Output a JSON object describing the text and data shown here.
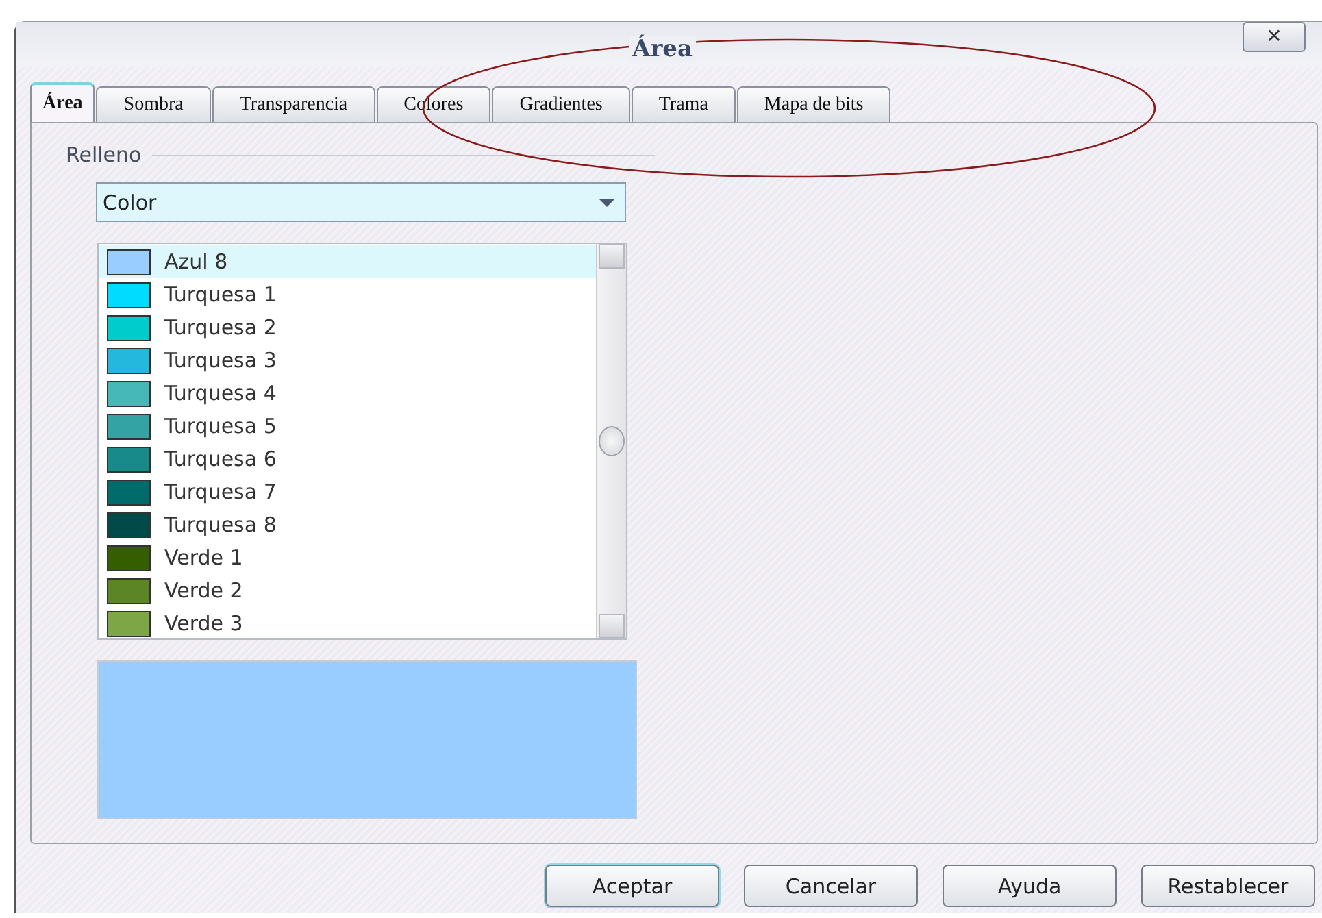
{
  "window": {
    "title": "Área",
    "close": "✕"
  },
  "tabs": [
    {
      "label": "Área",
      "selected": true
    },
    {
      "label": "Sombra",
      "selected": false
    },
    {
      "label": "Transparencia",
      "selected": false
    },
    {
      "label": "Colores",
      "selected": false
    },
    {
      "label": "Gradientes",
      "selected": false
    },
    {
      "label": "Trama",
      "selected": false
    },
    {
      "label": "Mapa de bits",
      "selected": false
    }
  ],
  "fill": {
    "label": "Relleno",
    "type": {
      "value": "Color"
    },
    "colors": [
      {
        "name": "Azul 8",
        "color": "#99ccff",
        "selected": true
      },
      {
        "name": "Turquesa 1",
        "color": "#00dcff",
        "selected": false
      },
      {
        "name": "Turquesa 2",
        "color": "#00cccc",
        "selected": false
      },
      {
        "name": "Turquesa 3",
        "color": "#23b8dc",
        "selected": false
      },
      {
        "name": "Turquesa 4",
        "color": "#47b8b8",
        "selected": false
      },
      {
        "name": "Turquesa 5",
        "color": "#33a3a3",
        "selected": false
      },
      {
        "name": "Turquesa 6",
        "color": "#198a8a",
        "selected": false
      },
      {
        "name": "Turquesa 7",
        "color": "#006b6b",
        "selected": false
      },
      {
        "name": "Turquesa 8",
        "color": "#004a4a",
        "selected": false
      },
      {
        "name": "Verde 1",
        "color": "#355e00",
        "selected": false
      },
      {
        "name": "Verde 2",
        "color": "#5c8526",
        "selected": false
      },
      {
        "name": "Verde 3",
        "color": "#7da647",
        "selected": false
      }
    ],
    "preview": {
      "color": "#99ccff"
    }
  },
  "buttons": [
    {
      "label": "Aceptar",
      "default": true
    },
    {
      "label": "Cancelar",
      "default": false
    },
    {
      "label": "Ayuda",
      "default": false
    },
    {
      "label": "Restablecer",
      "default": false
    }
  ]
}
